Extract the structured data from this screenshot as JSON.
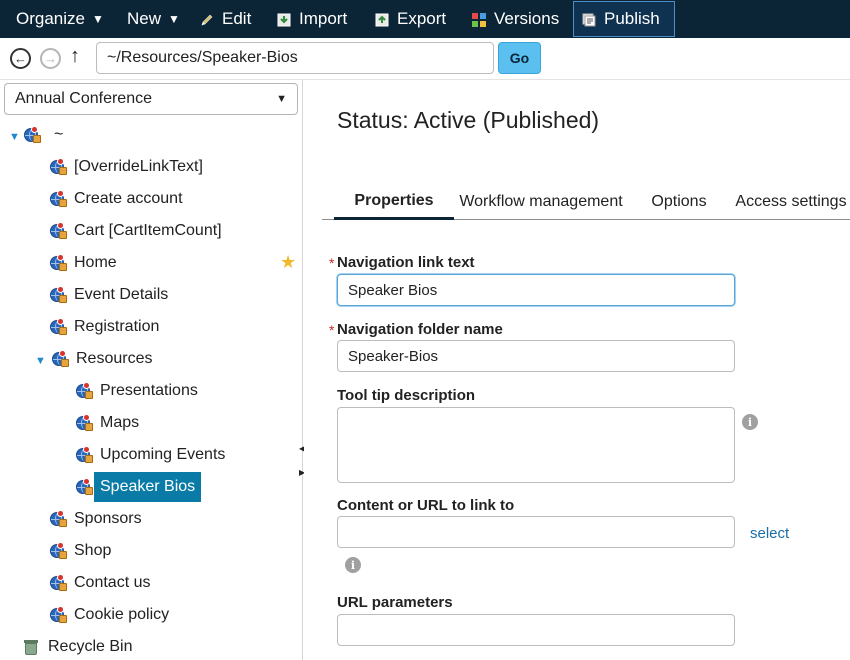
{
  "toolbar": {
    "organize_label": "Organize",
    "new_label": "New",
    "edit_label": "Edit",
    "import_label": "Import",
    "export_label": "Export",
    "versions_label": "Versions",
    "publish_label": "Publish"
  },
  "addressbar": {
    "path_value": "~/Resources/Speaker-Bios",
    "go_label": "Go"
  },
  "sidebar": {
    "site_selected": "Annual Conference",
    "root_label": "~",
    "items": [
      {
        "label": "[OverrideLinkText]"
      },
      {
        "label": "Create account"
      },
      {
        "label": "Cart [CartItemCount]"
      },
      {
        "label": "Home"
      },
      {
        "label": "Event Details"
      },
      {
        "label": "Registration"
      },
      {
        "label": "Resources"
      },
      {
        "label": "Presentations"
      },
      {
        "label": "Maps"
      },
      {
        "label": "Upcoming Events"
      },
      {
        "label": "Speaker Bios"
      },
      {
        "label": "Sponsors"
      },
      {
        "label": "Shop"
      },
      {
        "label": "Contact us"
      },
      {
        "label": "Cookie policy"
      }
    ],
    "recycle_bin_label": "Recycle Bin"
  },
  "main": {
    "status_title": "Status: Active (Published)",
    "tabs": [
      {
        "label": "Properties"
      },
      {
        "label": "Workflow management"
      },
      {
        "label": "Options"
      },
      {
        "label": "Access settings"
      }
    ],
    "fields": {
      "nav_link_text_label": "Navigation link text",
      "nav_link_text_value": "Speaker Bios",
      "nav_folder_name_label": "Navigation folder name",
      "nav_folder_name_value": "Speaker-Bios",
      "tooltip_label": "Tool tip description",
      "content_url_label": "Content or URL to link to",
      "select_link_label": "select",
      "url_params_label": "URL parameters"
    }
  },
  "colors": {
    "toolbar_bg": "#0b2536",
    "go_button": "#5bc0f0",
    "selected_item_bg": "#0a7aa6",
    "link": "#1c6ea4",
    "required_star": "#c92a2a",
    "star_icon": "#f1b92b"
  }
}
